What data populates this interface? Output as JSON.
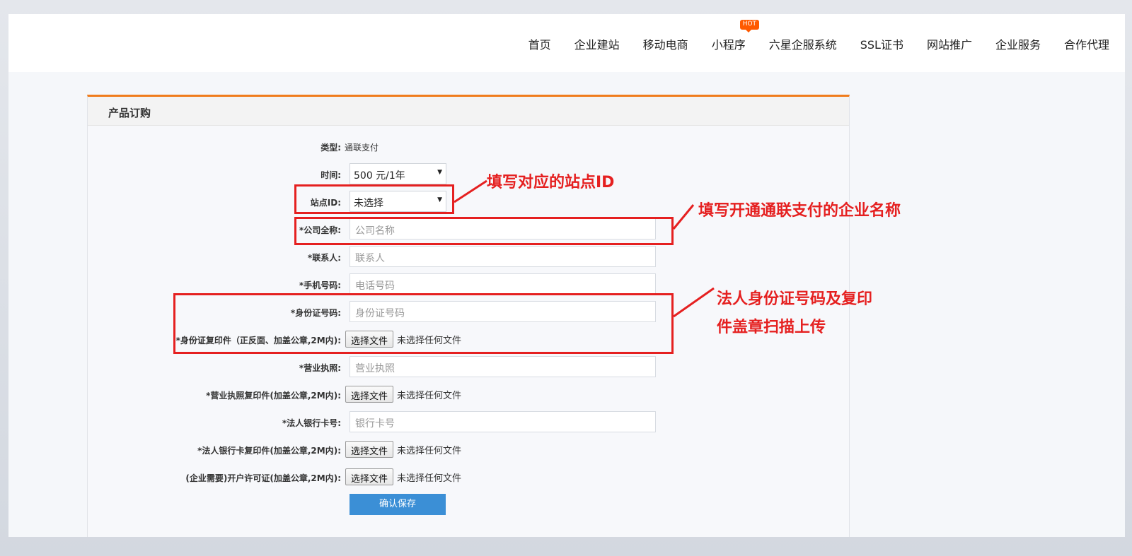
{
  "nav": {
    "items": [
      "首页",
      "企业建站",
      "移动电商",
      "小程序",
      "六星企服系统",
      "SSL证书",
      "网站推广",
      "企业服务",
      "合作代理"
    ],
    "hot_badge": "HOT"
  },
  "panel": {
    "title": "产品订购"
  },
  "form": {
    "type_label": "类型:",
    "type_value": "通联支付",
    "time_label": "时间:",
    "time_value": "500 元/1年",
    "site_label": "站点ID:",
    "site_value": "未选择",
    "company_label": "*公司全称:",
    "company_placeholder": "公司名称",
    "contact_label": "*联系人:",
    "contact_placeholder": "联系人",
    "phone_label": "*手机号码:",
    "phone_placeholder": "电话号码",
    "idno_label": "*身份证号码:",
    "idno_placeholder": "身份证号码",
    "idcopy_label": "*身份证复印件（正反面、加盖公章,2M内):",
    "license_label": "*营业执照:",
    "license_placeholder": "营业执照",
    "licensecopy_label": "*营业执照复印件(加盖公章,2M内):",
    "bank_label": "*法人银行卡号:",
    "bank_placeholder": "银行卡号",
    "bankcopy_label": "*法人银行卡复印件(加盖公章,2M内):",
    "permit_label": "(企业需要)开户许可证(加盖公章,2M内):",
    "file_button": "选择文件",
    "file_status": "未选择任何文件",
    "save_button": "确认保存"
  },
  "annotations": {
    "site_note": "填写对应的站点ID",
    "company_note": "填写开通通联支付的企业名称",
    "id_note_line1": "法人身份证号码及复印",
    "id_note_line2": "件盖章扫描上传"
  },
  "colors": {
    "accent": "#f07c1c",
    "annotation": "#e52020",
    "primary_button": "#3b8fd6",
    "hot_badge": "#ff5a00"
  }
}
